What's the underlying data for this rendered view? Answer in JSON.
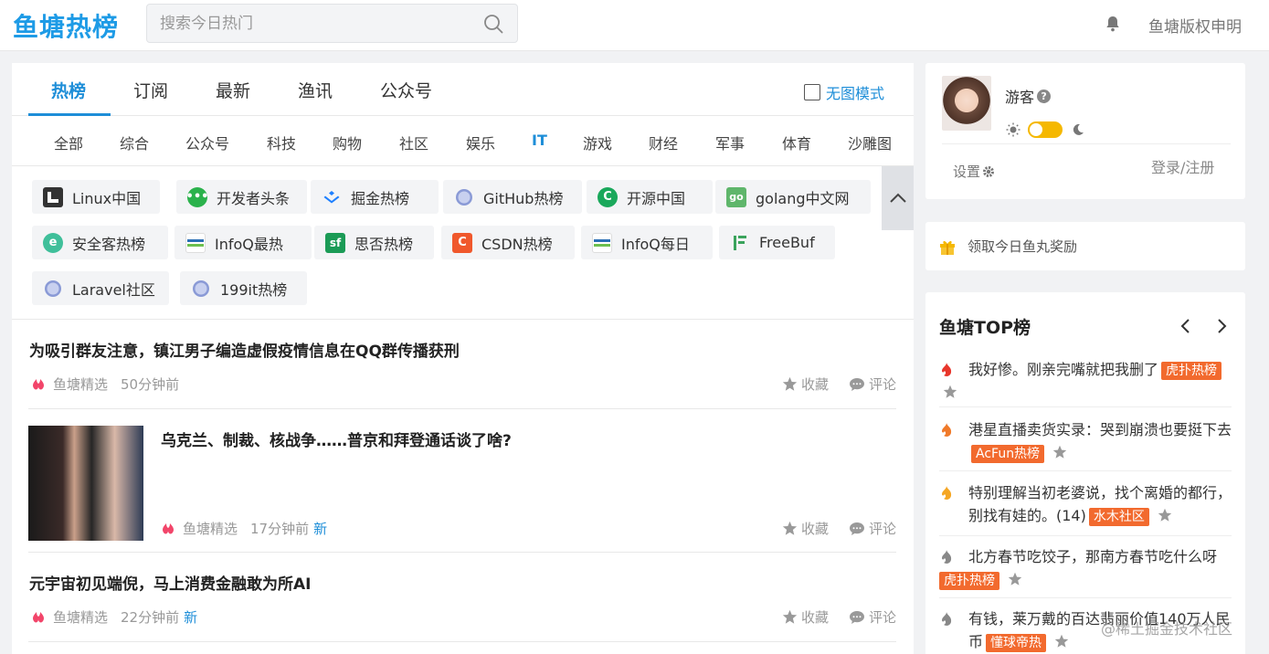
{
  "header": {
    "logo": "鱼塘热榜",
    "search_placeholder": "搜索今日热门",
    "copyright_label": "鱼塘版权申明"
  },
  "tabs": [
    "热榜",
    "订阅",
    "最新",
    "渔讯",
    "公众号"
  ],
  "active_tab": "热榜",
  "no_image_mode": "无图模式",
  "categories": [
    "全部",
    "综合",
    "公众号",
    "科技",
    "购物",
    "社区",
    "娱乐",
    "IT",
    "游戏",
    "财经",
    "军事",
    "体育",
    "沙雕图"
  ],
  "active_category": "IT",
  "sources": [
    {
      "label": "Linux中国",
      "icon": "linux-cn-icon",
      "color": "#333333"
    },
    {
      "label": "开发者头条",
      "icon": "wechat-icon",
      "color": "#2bb24c"
    },
    {
      "label": "掘金热榜",
      "icon": "juejin-icon",
      "color": "#1e80ff"
    },
    {
      "label": "GitHub热榜",
      "icon": "globe-icon",
      "color": "#8a9ad6"
    },
    {
      "label": "开源中国",
      "icon": "oschina-icon",
      "color": "#1aa85b"
    },
    {
      "label": "golang中文网",
      "icon": "golang-icon",
      "color": "#5fb66b"
    },
    {
      "label": "安全客热榜",
      "icon": "anquanke-icon",
      "color": "#3fbf9a"
    },
    {
      "label": "InfoQ最热",
      "icon": "infoq-icon",
      "color": "#2a6fb5"
    },
    {
      "label": "思否热榜",
      "icon": "segmentfault-icon",
      "color": "#1b9b56"
    },
    {
      "label": "CSDN热榜",
      "icon": "csdn-icon",
      "color": "#f0582c"
    },
    {
      "label": "InfoQ每日",
      "icon": "infoq-icon",
      "color": "#2a6fb5"
    },
    {
      "label": "FreeBuf",
      "icon": "freebuf-icon",
      "color": "#3aa35c"
    },
    {
      "label": "Laravel社区",
      "icon": "globe-icon",
      "color": "#8a9ad6"
    },
    {
      "label": "199it热榜",
      "icon": "globe-icon",
      "color": "#8a9ad6"
    }
  ],
  "articles": [
    {
      "title": "为吸引群友注意，镇江男子编造虚假疫情信息在QQ群传播获刑",
      "source": "鱼塘精选",
      "time": "50分钟前",
      "new": "",
      "fav": "收藏",
      "comment": "评论"
    },
    {
      "title": "乌克兰、制裁、核战争……普京和拜登通话谈了啥?",
      "source": "鱼塘精选",
      "time": "17分钟前",
      "new": "新",
      "fav": "收藏",
      "comment": "评论"
    },
    {
      "title": "元宇宙初见端倪，马上消费金融敢为所AI",
      "source": "鱼塘精选",
      "time": "22分钟前",
      "new": "新",
      "fav": "收藏",
      "comment": "评论"
    }
  ],
  "user": {
    "name": "游客",
    "help": "?",
    "settings": "设置",
    "login": "登录/注册"
  },
  "reward": "领取今日鱼丸奖励",
  "top": {
    "title": "鱼塘TOP榜",
    "items": [
      {
        "text": "我好惨。刚亲完嘴就把我删了",
        "tag": "虎扑热榜",
        "tag_color": "#f26a2e",
        "fire_color": "#e8362b"
      },
      {
        "text": "港星直播卖货实录：哭到崩溃也要挺下去",
        "tag": "AcFun热榜",
        "tag_color": "#f26a2e",
        "fire_color": "#f07a2a"
      },
      {
        "text": "特别理解当初老婆说，找个离婚的都行，别找有娃的。(14)",
        "tag": "水木社区",
        "tag_color": "#f26a2e",
        "fire_color": "#f5a623"
      },
      {
        "text": "北方春节吃饺子，那南方春节吃什么呀",
        "tag": "虎扑热榜",
        "tag_color": "#f26a2e",
        "fire_color": "#888888"
      },
      {
        "text": "有钱，莱万戴的百达翡丽价值140万人民币",
        "tag": "懂球帝热",
        "tag_color": "#f26a2e",
        "fire_color": "#888888"
      }
    ]
  },
  "watermark": "@稀土掘金技术社区"
}
